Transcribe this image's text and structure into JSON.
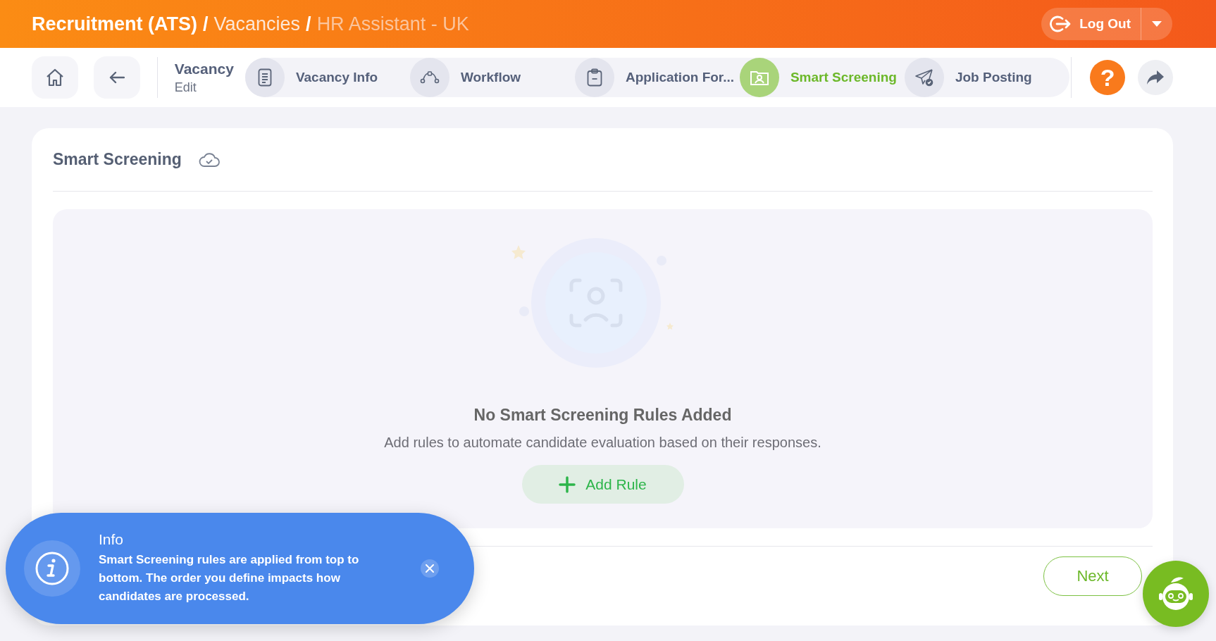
{
  "header": {
    "breadcrumb": [
      "Recruitment (ATS)",
      "Vacancies",
      "HR Assistant - UK"
    ],
    "separator": "/",
    "logout": "Log Out"
  },
  "nav": {
    "title": "Vacancy",
    "subtitle": "Edit",
    "steps": [
      {
        "label": "Vacancy Info",
        "selected": false
      },
      {
        "label": "Workflow",
        "selected": false
      },
      {
        "label": "Application For...",
        "selected": false
      },
      {
        "label": "Smart Screening",
        "selected": true
      },
      {
        "label": "Job Posting",
        "selected": false
      }
    ],
    "help": "?"
  },
  "card": {
    "title": "Smart Screening",
    "empty": {
      "heading": "No Smart Screening Rules Added",
      "text": "Add rules to automate candidate evaluation based on their responses.",
      "button": "Add Rule"
    },
    "next": "Next"
  },
  "toast": {
    "title": "Info",
    "message": "Smart Screening rules are applied from top to bottom. The order you define impacts how candidates are processed."
  }
}
